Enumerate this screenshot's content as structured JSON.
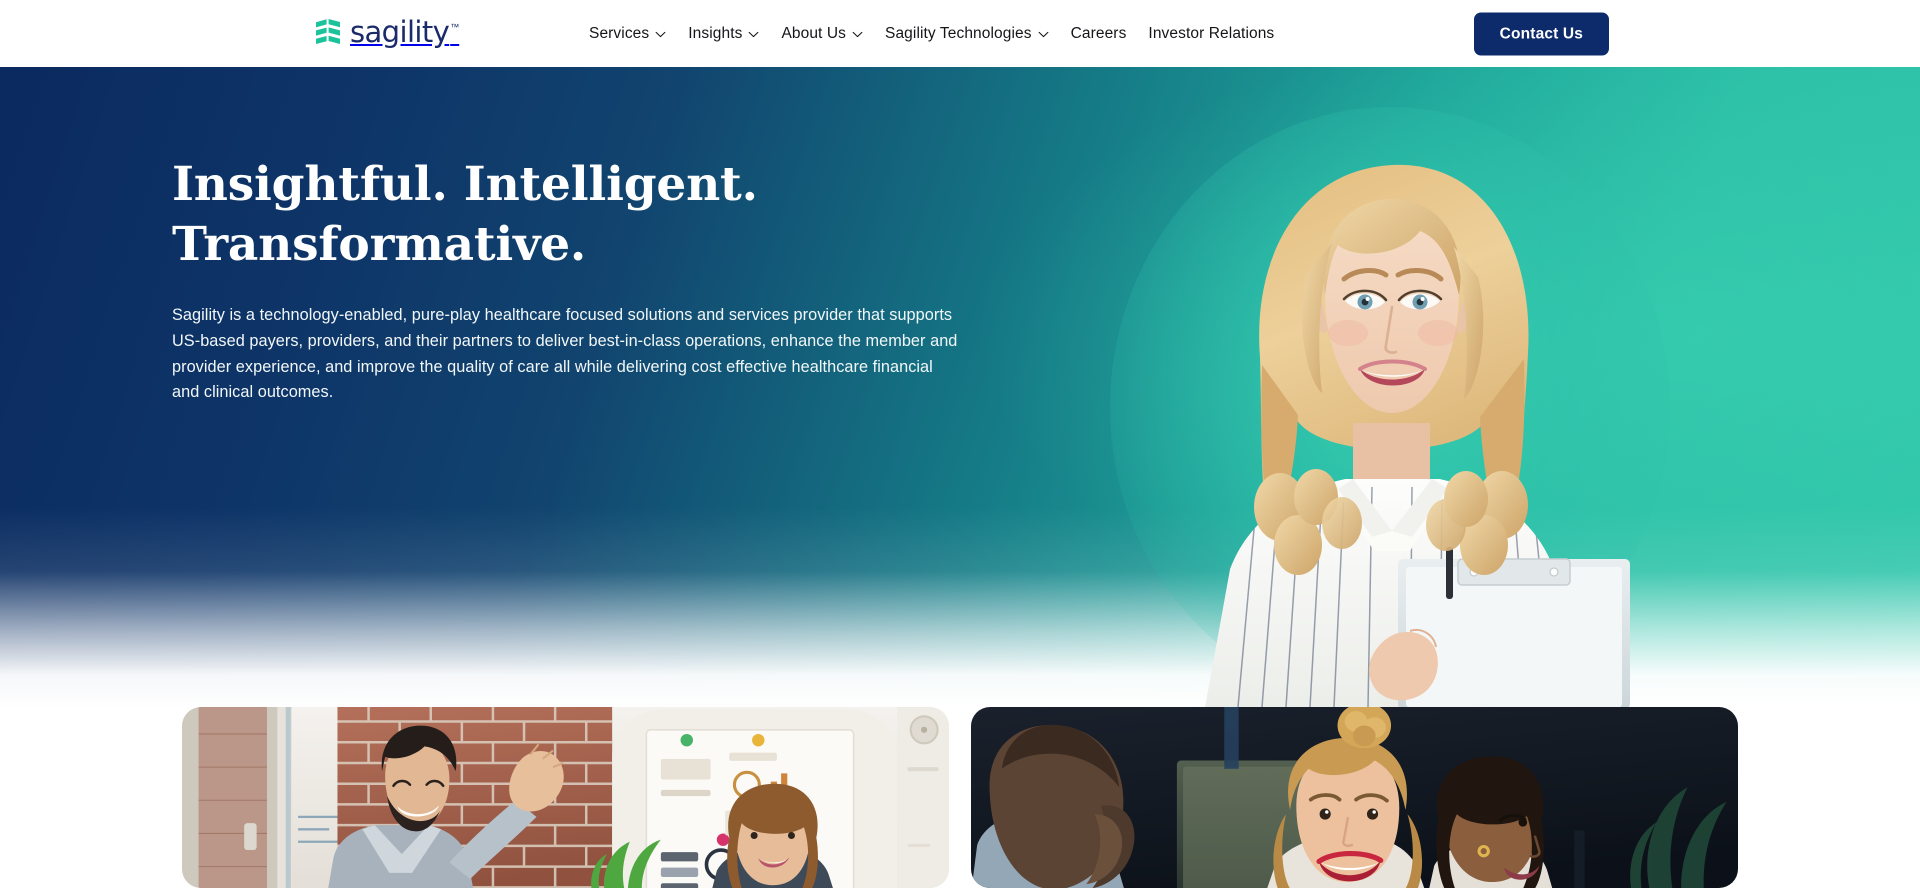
{
  "brand": {
    "logo_text": "sagility",
    "logo_tm": "™",
    "logo_mark_icon": "sagility-s-mark-icon",
    "navy": "#0d2a6b",
    "teal": "#2cbca9",
    "green": "#1fc08a"
  },
  "header": {
    "nav": [
      {
        "label": "Services",
        "has_dropdown": true
      },
      {
        "label": "Insights",
        "has_dropdown": true
      },
      {
        "label": "About Us",
        "has_dropdown": true
      },
      {
        "label": "Sagility Technologies",
        "has_dropdown": true
      },
      {
        "label": "Careers",
        "has_dropdown": false
      },
      {
        "label": "Investor Relations",
        "has_dropdown": false
      }
    ],
    "cta_label": "Contact Us"
  },
  "hero": {
    "title_line1": "Insightful. Intelligent.",
    "title_line2": "Transformative.",
    "body": "Sagility is a technology-enabled, pure-play healthcare focused solutions and services provider that supports US-based payers, providers, and their partners to deliver best-in-class operations, enhance the member and provider experience, and improve the quality of care all while delivering cost effective healthcare financial and clinical outcomes.",
    "photo_alt": "smiling-woman-holding-clipboard"
  },
  "cards": [
    {
      "alt": "colleagues-high-five-in-office-with-brick-wall-and-whiteboard"
    },
    {
      "alt": "smiling-team-members-in-dark-modern-office"
    }
  ]
}
